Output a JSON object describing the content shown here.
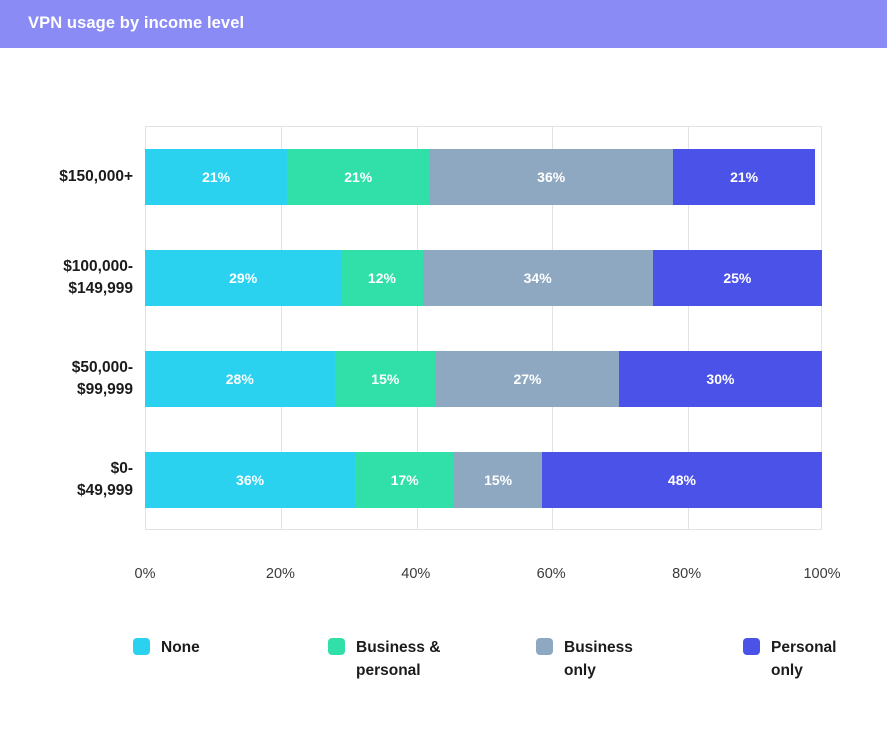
{
  "header": {
    "title": "VPN usage by income level",
    "background_color": "#8b8bf5",
    "text_color": "#ffffff"
  },
  "chart_data": {
    "type": "bar",
    "orientation": "horizontal",
    "stacked": true,
    "stack_mode": "percent",
    "title": "VPN usage by income level",
    "xlabel": "",
    "ylabel": "",
    "xlim": [
      0,
      100
    ],
    "xticks": [
      "0%",
      "20%",
      "40%",
      "60%",
      "80%",
      "100%"
    ],
    "xtick_values": [
      0,
      20,
      40,
      60,
      80,
      100
    ],
    "grid": true,
    "legend_position": "bottom",
    "categories": [
      "$150,000+",
      "$100,000-$149,999",
      "$50,000-$99,999",
      "$0-$49,999"
    ],
    "category_lines": [
      [
        "$150,000+"
      ],
      [
        "$100,000-",
        "$149,999"
      ],
      [
        "$50,000-",
        "$99,999"
      ],
      [
        "$0-",
        "$49,999"
      ]
    ],
    "series": [
      {
        "name": "None",
        "legend_lines": [
          "None"
        ],
        "color": "#2bd2f0",
        "values": [
          21,
          29,
          28,
          36
        ],
        "labels": [
          "21%",
          "29%",
          "28%",
          "36%"
        ]
      },
      {
        "name": "Business & personal",
        "legend_lines": [
          "Business &",
          "personal"
        ],
        "color": "#31e0a8",
        "values": [
          21,
          12,
          15,
          17
        ],
        "labels": [
          "21%",
          "12%",
          "15%",
          "17%"
        ]
      },
      {
        "name": "Business only",
        "legend_lines": [
          "Business",
          "only"
        ],
        "color": "#8fa8c2",
        "values": [
          36,
          34,
          27,
          15
        ],
        "labels": [
          "36%",
          "34%",
          "27%",
          "15%"
        ]
      },
      {
        "name": "Personal only",
        "legend_lines": [
          "Personal",
          "only"
        ],
        "color": "#4b52e8",
        "values": [
          21,
          25,
          30,
          48
        ],
        "labels": [
          "21%",
          "25%",
          "30%",
          "48%"
        ]
      }
    ],
    "grid_color": "#e3e3e3",
    "plot_background": "#ffffff"
  }
}
